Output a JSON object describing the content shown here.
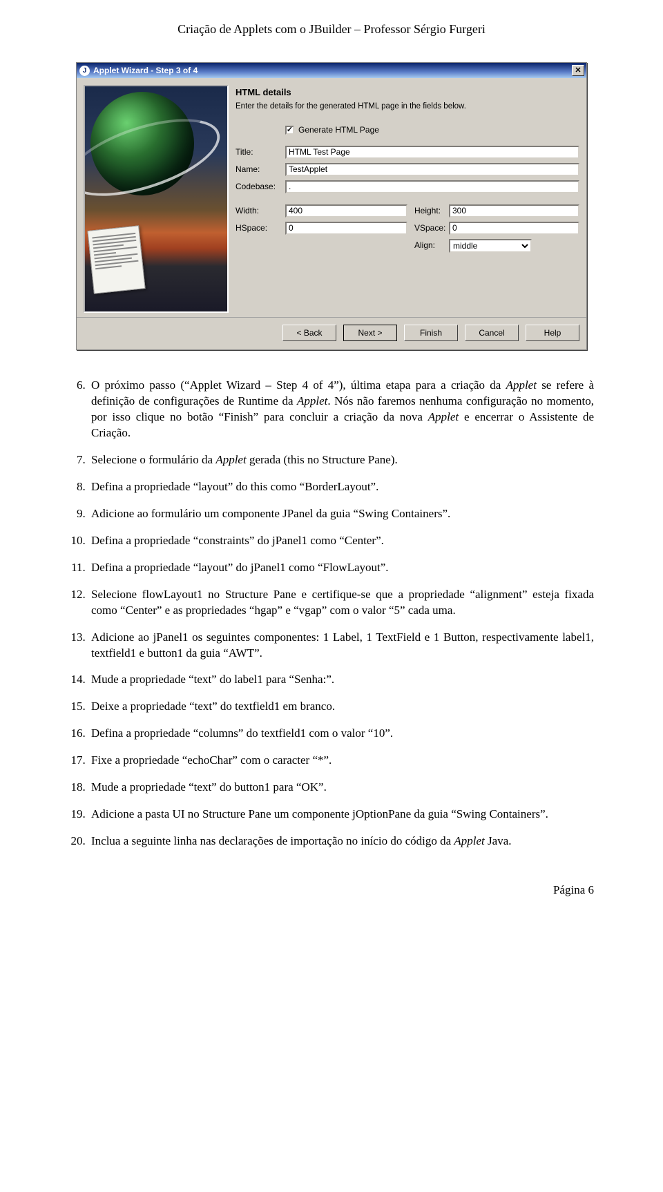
{
  "header": "Criação de Applets com o JBuilder – Professor Sérgio Furgeri",
  "window": {
    "title": "Applet Wizard - Step 3 of 4",
    "heading": "HTML details",
    "subheading": "Enter the details for the generated HTML page in the fields below.",
    "generate_checked": true,
    "generate_label": "Generate HTML Page",
    "labels": {
      "title": "Title:",
      "name": "Name:",
      "codebase": "Codebase:",
      "width": "Width:",
      "height": "Height:",
      "hspace": "HSpace:",
      "vspace": "VSpace:",
      "align": "Align:"
    },
    "values": {
      "title": "HTML Test Page",
      "name": "TestApplet",
      "codebase": ".",
      "width": "400",
      "height": "300",
      "hspace": "0",
      "vspace": "0",
      "align": "middle"
    },
    "buttons": {
      "back": "< Back",
      "next": "Next >",
      "finish": "Finish",
      "cancel": "Cancel",
      "help": "Help"
    }
  },
  "steps": [
    "O próximo passo (\"Applet Wizard – Step 4 of 4\"), última etapa para a criação da Applet se refere à definição de configurações de Runtime da Applet. Nós não faremos nenhuma configuração no momento, por isso clique no botão \"Finish\" para concluir a criação da nova Applet e encerrar o Assistente de Criação.",
    "Selecione o formulário da Applet gerada (this no Structure Pane).",
    "Defina a propriedade \"layout\" do this como \"BorderLayout\".",
    "Adicione ao formulário um componente JPanel da guia \"Swing Containers\".",
    "Defina a propriedade \"constraints\" do jPanel1 como \"Center\".",
    "Defina a propriedade \"layout\" do jPanel1 como \"FlowLayout\".",
    "Selecione flowLayout1 no Structure Pane e certifique-se que a propriedade \"alignment\" esteja fixada como \"Center\" e as propriedades \"hgap\" e \"vgap\" com o valor \"5\" cada uma.",
    "Adicione ao jPanel1 os seguintes componentes: 1 Label, 1 TextField e 1 Button, respectivamente label1, textfield1 e button1 da guia \"AWT\".",
    "Mude a propriedade \"text\" do label1 para \"Senha:\".",
    "Deixe a propriedade \"text\" do textfield1 em branco.",
    "Defina a propriedade \"columns\" do textfield1 com o valor \"10\".",
    "Fixe a propriedade \"echoChar\" com o caracter \"*\".",
    "Mude a propriedade \"text\" do button1 para \"OK\".",
    "Adicione a pasta UI no Structure Pane um componente jOptionPane da guia \"Swing Containers\".",
    "Inclua a seguinte linha nas declarações de importação no início do código da Applet Java."
  ],
  "footer": "Página 6"
}
